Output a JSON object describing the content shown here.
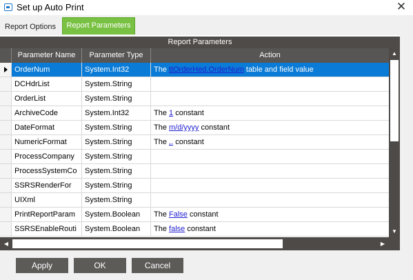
{
  "window": {
    "title": "Set up Auto Print",
    "close_symbol": "✕"
  },
  "tabs": [
    {
      "label": "Report Options",
      "active": false
    },
    {
      "label": "Report Parameters",
      "active": true
    }
  ],
  "panel": {
    "title": "Report Parameters"
  },
  "grid": {
    "columns": [
      "Parameter Name",
      "Parameter Type",
      "Action"
    ],
    "rows": [
      {
        "name": "OrderNum",
        "type": "System.Int32",
        "action": {
          "pre": "The ",
          "link": "ttOrderHed.OrderNum",
          "post": " table and field value"
        },
        "selected": true
      },
      {
        "name": "DCHdrList",
        "type": "System.String",
        "action": {
          "pre": "",
          "link": "",
          "post": ""
        }
      },
      {
        "name": "OrderList",
        "type": "System.String",
        "action": {
          "pre": "",
          "link": "",
          "post": ""
        }
      },
      {
        "name": "ArchiveCode",
        "type": "System.Int32",
        "action": {
          "pre": "The ",
          "link": "1",
          "post": " constant"
        }
      },
      {
        "name": "DateFormat",
        "type": "System.String",
        "action": {
          "pre": "The ",
          "link": "m/d/yyyy",
          "post": " constant"
        }
      },
      {
        "name": "NumericFormat",
        "type": "System.String",
        "action": {
          "pre": "The ",
          "link": ",.",
          "post": " constant"
        }
      },
      {
        "name": "ProcessCompany",
        "type": "System.String",
        "action": {
          "pre": "",
          "link": "",
          "post": ""
        }
      },
      {
        "name": "ProcessSystemCo",
        "type": "System.String",
        "action": {
          "pre": "",
          "link": "",
          "post": ""
        }
      },
      {
        "name": "SSRSRenderFor",
        "type": "System.String",
        "action": {
          "pre": "",
          "link": "",
          "post": ""
        }
      },
      {
        "name": "UIXml",
        "type": "System.String",
        "action": {
          "pre": "",
          "link": "",
          "post": ""
        }
      },
      {
        "name": "PrintReportParam",
        "type": "System.Boolean",
        "action": {
          "pre": "The ",
          "link": "False",
          "post": " constant"
        }
      },
      {
        "name": "SSRSEnableRouti",
        "type": "System.Boolean",
        "action": {
          "pre": "The ",
          "link": "false",
          "post": " constant"
        }
      }
    ]
  },
  "scrollbars": {
    "up": "▲",
    "down": "▼",
    "left": "◀",
    "right": "▶"
  },
  "buttons": {
    "apply": "Apply",
    "ok": "OK",
    "cancel": "Cancel"
  },
  "colors": {
    "accent_green": "#79c143",
    "selection_blue": "#0a7bd6",
    "header_dark": "#585654",
    "button_gray": "#5d5b58",
    "link_blue": "#1f1fd0"
  }
}
